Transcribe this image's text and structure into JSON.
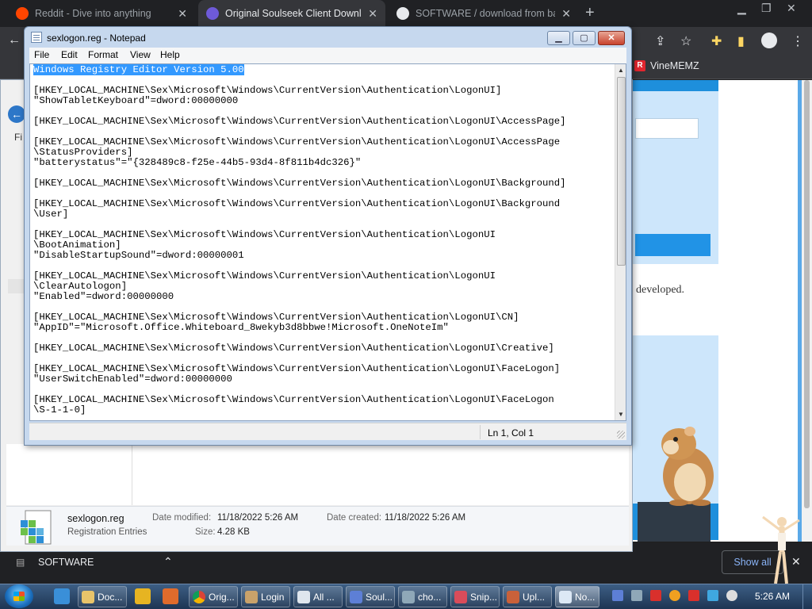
{
  "browser": {
    "tabs": [
      {
        "title": "Reddit - Dive into anything",
        "active": false
      },
      {
        "title": "Original Soulseek Client Download",
        "active": true
      },
      {
        "title": "SOFTWARE / download from bandcamp",
        "active": false
      }
    ],
    "bookmark": "VineMEMZ"
  },
  "page": {
    "developed_text": "developed."
  },
  "downloads": {
    "item": "SOFTWARE",
    "show_all": "Show all"
  },
  "explorer": {
    "menu_fragment": "Fi",
    "file": {
      "name": "sexlogon.reg",
      "type": "Registration Entries",
      "modified_label": "Date modified:",
      "modified": "11/18/2022 5:26 AM",
      "created_label": "Date created:",
      "created": "11/18/2022 5:26 AM",
      "size_label": "Size:",
      "size": "4.28 KB"
    }
  },
  "notepad": {
    "title": "sexlogon.reg - Notepad",
    "menu": [
      "File",
      "Edit",
      "Format",
      "View",
      "Help"
    ],
    "status": "Ln 1, Col 1",
    "lines": [
      "Windows Registry Editor Version 5.00",
      "",
      "[HKEY_LOCAL_MACHINE\\Sex\\Microsoft\\Windows\\CurrentVersion\\Authentication\\LogonUI]",
      "\"ShowTabletKeyboard\"=dword:00000000",
      "",
      "[HKEY_LOCAL_MACHINE\\Sex\\Microsoft\\Windows\\CurrentVersion\\Authentication\\LogonUI\\AccessPage]",
      "",
      "[HKEY_LOCAL_MACHINE\\Sex\\Microsoft\\Windows\\CurrentVersion\\Authentication\\LogonUI\\AccessPage",
      "\\StatusProviders]",
      "\"batterystatus\"=\"{328489c8-f25e-44b5-93d4-8f811b4dc326}\"",
      "",
      "[HKEY_LOCAL_MACHINE\\Sex\\Microsoft\\Windows\\CurrentVersion\\Authentication\\LogonUI\\Background]",
      "",
      "[HKEY_LOCAL_MACHINE\\Sex\\Microsoft\\Windows\\CurrentVersion\\Authentication\\LogonUI\\Background",
      "\\User]",
      "",
      "[HKEY_LOCAL_MACHINE\\Sex\\Microsoft\\Windows\\CurrentVersion\\Authentication\\LogonUI",
      "\\BootAnimation]",
      "\"DisableStartupSound\"=dword:00000001",
      "",
      "[HKEY_LOCAL_MACHINE\\Sex\\Microsoft\\Windows\\CurrentVersion\\Authentication\\LogonUI",
      "\\ClearAutologon]",
      "\"Enabled\"=dword:00000000",
      "",
      "[HKEY_LOCAL_MACHINE\\Sex\\Microsoft\\Windows\\CurrentVersion\\Authentication\\LogonUI\\CN]",
      "\"AppID\"=\"Microsoft.Office.Whiteboard_8wekyb3d8bbwe!Microsoft.OneNoteIm\"",
      "",
      "[HKEY_LOCAL_MACHINE\\Sex\\Microsoft\\Windows\\CurrentVersion\\Authentication\\LogonUI\\Creative]",
      "",
      "[HKEY_LOCAL_MACHINE\\Sex\\Microsoft\\Windows\\CurrentVersion\\Authentication\\LogonUI\\FaceLogon]",
      "\"UserSwitchEnabled\"=dword:00000000",
      "",
      "[HKEY_LOCAL_MACHINE\\Sex\\Microsoft\\Windows\\CurrentVersion\\Authentication\\LogonUI\\FaceLogon",
      "\\S-1-1-0]"
    ]
  },
  "taskbar": {
    "buttons": [
      "Doc...",
      "Orig...",
      "Login",
      "All ...",
      "Soul...",
      "cho...",
      "Snip...",
      "Upl...",
      "No..."
    ],
    "clock": "5:26 AM"
  },
  "colors": {
    "selection": "#3399ff",
    "chrome_dark": "#202124",
    "show_all_link": "#8ab4f8"
  }
}
